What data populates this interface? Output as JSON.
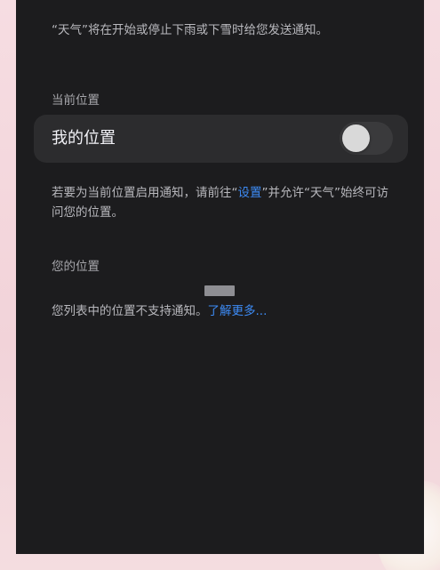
{
  "top_note": "“天气”将在开始或停止下雨或下雪时给您发送通知。",
  "current_location": {
    "section_label": "当前位置",
    "row_label": "我的位置",
    "toggle_state": "off"
  },
  "permission_note": {
    "before": "若要为当前位置启用通知，请前往“",
    "settings_link": "设置",
    "after": "”并允许“天气”始终可访问您的位置。"
  },
  "your_locations": {
    "section_label": "您的位置",
    "unsupported_text": "您列表中的位置不支持通知。",
    "learn_more_link": "了解更多..."
  },
  "colors": {
    "screen_bg": "#1c1c1e",
    "row_bg": "#2c2c2e",
    "link": "#3d8bf5",
    "frame_bg": "#f3d9de"
  }
}
